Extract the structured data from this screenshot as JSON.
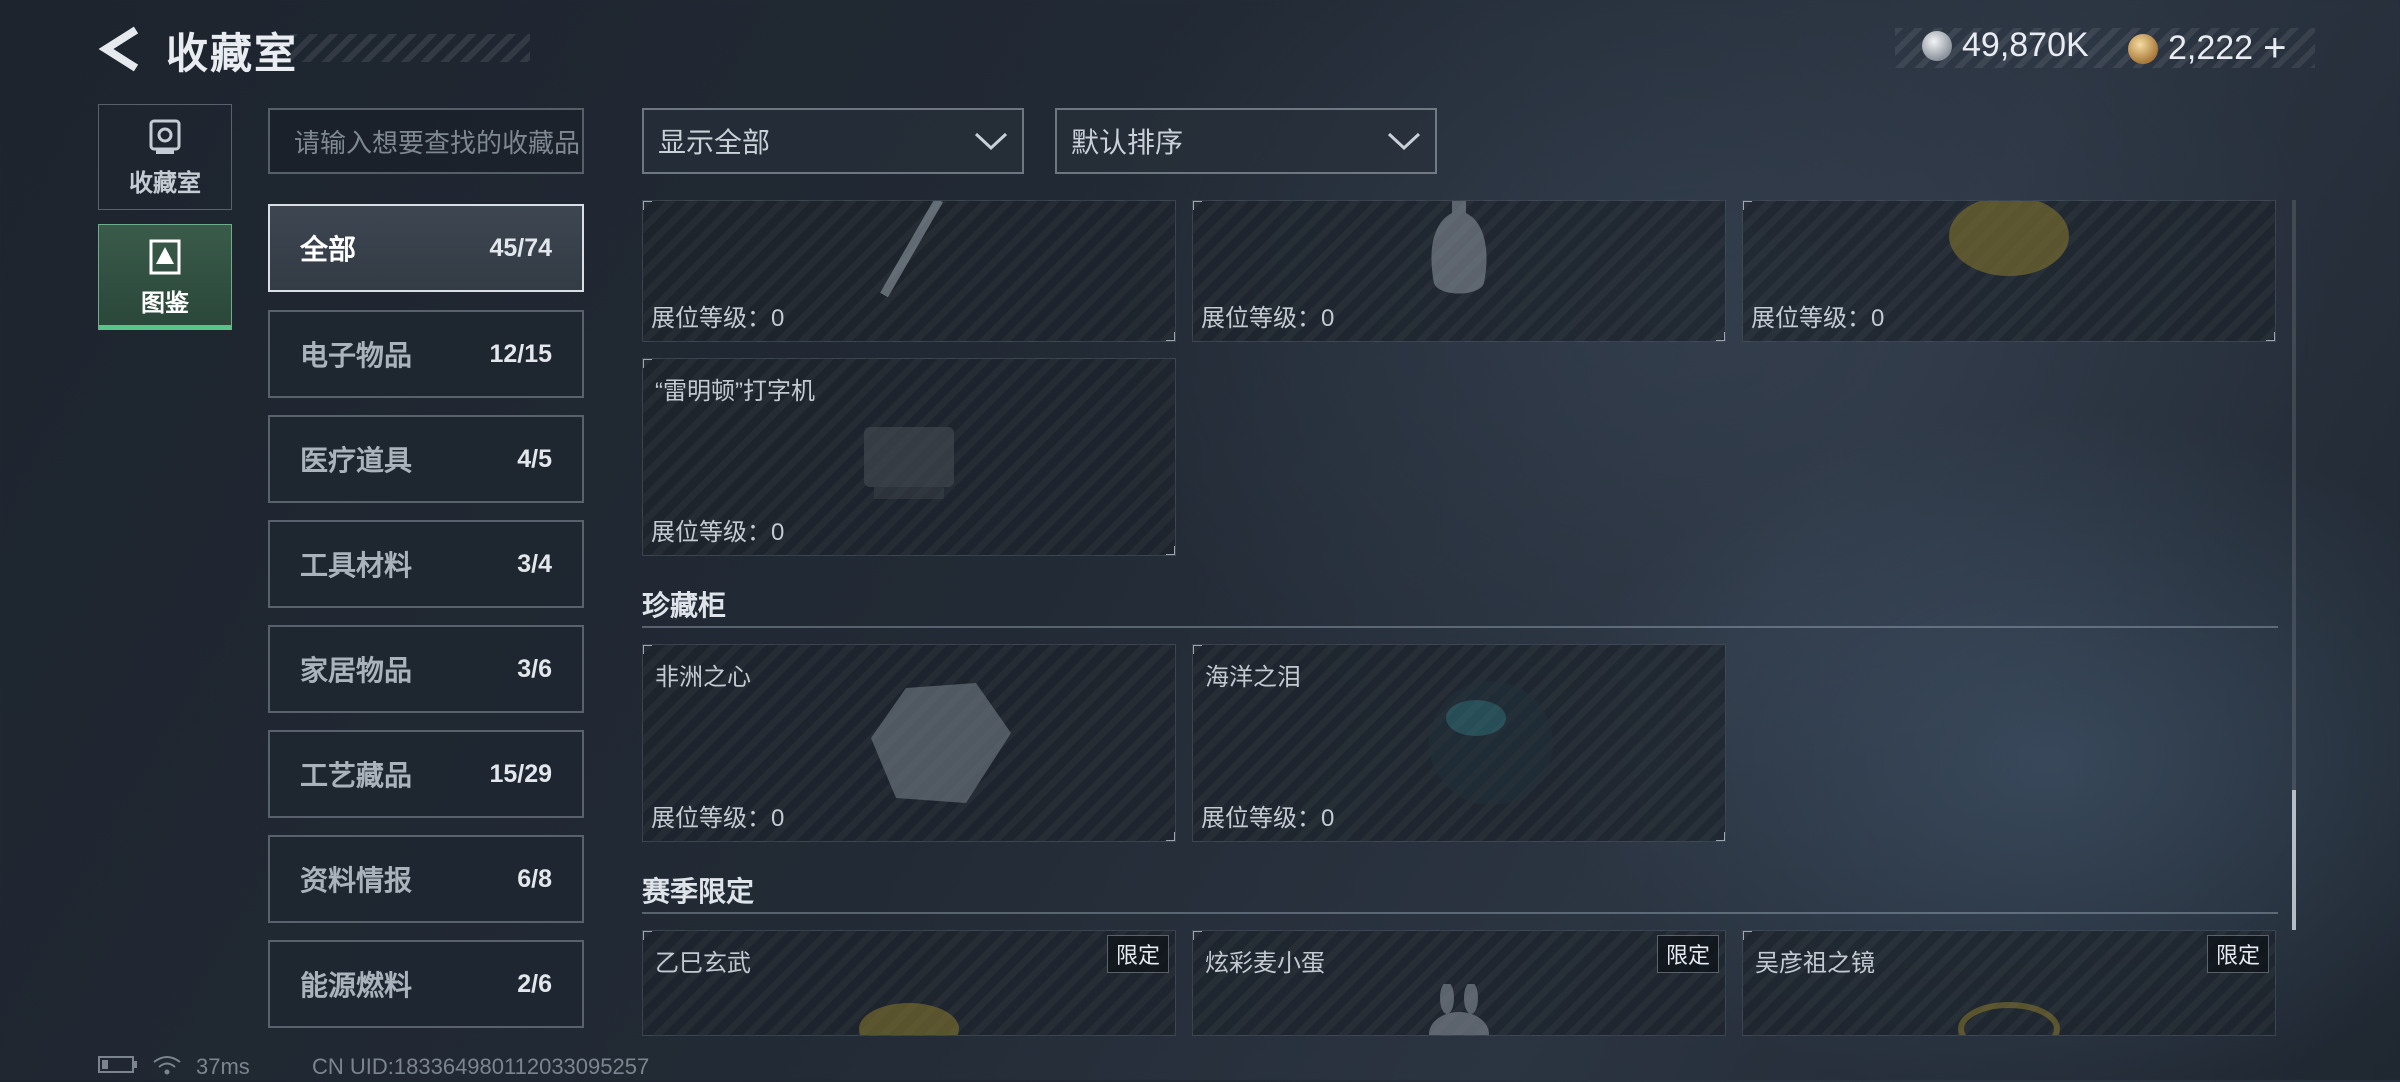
{
  "header": {
    "title": "收藏室",
    "currencies": [
      {
        "icon": "silver-coin-icon",
        "value": "49,870K"
      },
      {
        "icon": "gold-coin-icon",
        "value": "2,222"
      }
    ],
    "add_label": "+"
  },
  "mode_tabs": [
    {
      "label": "收藏室",
      "icon": "collection-room-icon",
      "active": false
    },
    {
      "label": "图鉴",
      "icon": "codex-icon",
      "active": true
    }
  ],
  "search": {
    "placeholder": "请输入想要查找的收藏品"
  },
  "categories": [
    {
      "label": "全部",
      "count": "45/74",
      "active": true
    },
    {
      "label": "电子物品",
      "count": "12/15"
    },
    {
      "label": "医疗道具",
      "count": "4/5"
    },
    {
      "label": "工具材料",
      "count": "3/4"
    },
    {
      "label": "家居物品",
      "count": "3/6"
    },
    {
      "label": "工艺藏品",
      "count": "15/29"
    },
    {
      "label": "资料情报",
      "count": "6/8"
    },
    {
      "label": "能源燃料",
      "count": "2/6"
    }
  ],
  "filters": {
    "show": "显示全部",
    "sort": "默认排序"
  },
  "cards_top": [
    {
      "name": "",
      "level": "展位等级：0",
      "art": "pen"
    },
    {
      "name": "",
      "level": "展位等级：0",
      "art": "vase"
    },
    {
      "name": "",
      "level": "展位等级：0",
      "art": "gold-statue"
    },
    {
      "name": "“雷明顿”打字机",
      "level": "展位等级：0",
      "art": "typewriter"
    }
  ],
  "sections": [
    {
      "title": "珍藏柜",
      "cards": [
        {
          "name": "非洲之心",
          "level": "展位等级：0",
          "art": "diamond"
        },
        {
          "name": "海洋之泪",
          "level": "展位等级：0",
          "art": "blue-gem"
        }
      ]
    },
    {
      "title": "赛季限定",
      "cards": [
        {
          "name": "乙巳玄武",
          "badge": "限定",
          "art": "tortoise"
        },
        {
          "name": "炫彩麦小蛋",
          "badge": "限定",
          "art": "rabbit"
        },
        {
          "name": "吴彦祖之镜",
          "badge": "限定",
          "art": "mirror"
        }
      ]
    }
  ],
  "status": {
    "ping": "37ms",
    "uid": "CN UID:18336498011203309525​7"
  }
}
